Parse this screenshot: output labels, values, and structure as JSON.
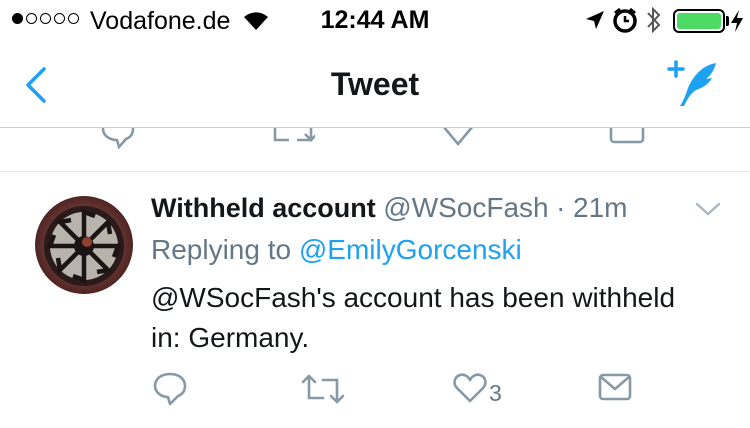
{
  "status_bar": {
    "carrier": "Vodafone.de",
    "time": "12:44 AM",
    "signal_bars": 1,
    "signal_total": 5,
    "battery_level": 1.0,
    "battery_color": "#4cd964",
    "icons": [
      "wifi-icon",
      "location-arrow-icon",
      "alarm-clock-icon",
      "bluetooth-icon",
      "battery-icon",
      "charging-bolt-icon"
    ]
  },
  "nav": {
    "title": "Tweet",
    "back_icon": "chevron-left-icon",
    "compose_icon": "compose-tweet-icon",
    "accent": "#1da1f2"
  },
  "previous_tweet_actions": [
    "reply-icon",
    "retweet-icon",
    "like-icon",
    "share-icon"
  ],
  "tweet": {
    "name": "Withheld account",
    "handle": "@WSocFash",
    "separator": "·",
    "time": "21m",
    "replying_prefix": "Replying to",
    "replying_to": "@EmilyGorcenski",
    "text": "@WSocFash's account has been withheld in: Germany.",
    "like_count": "3",
    "actions": [
      "reply-icon",
      "retweet-icon",
      "like-icon",
      "share-icon"
    ],
    "colors": {
      "text": "#14171a",
      "secondary": "#657786",
      "link": "#1da1f2"
    }
  }
}
